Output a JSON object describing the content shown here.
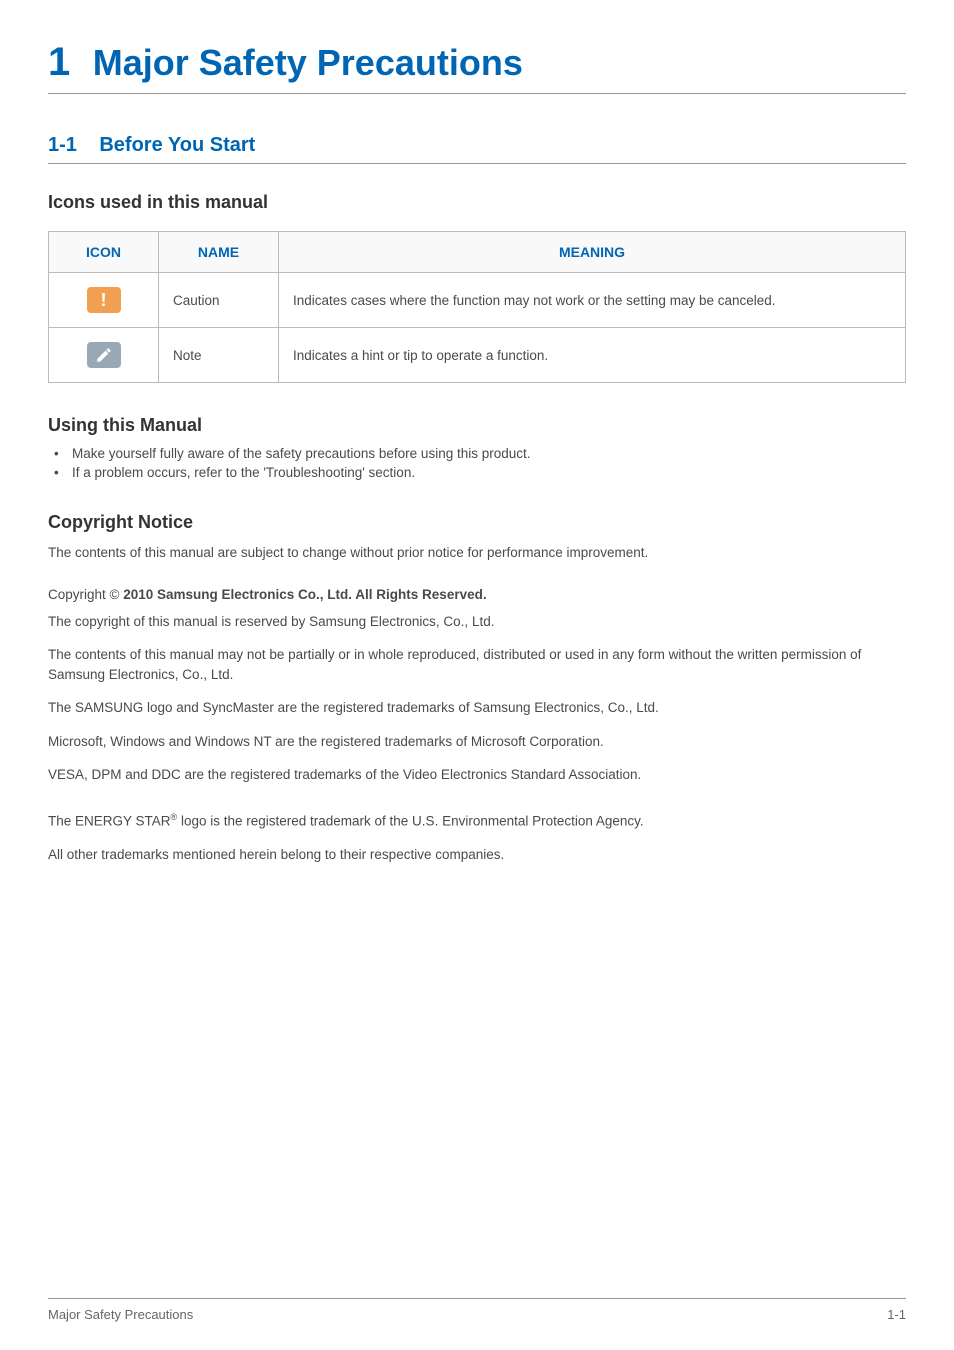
{
  "chapter": {
    "number": "1",
    "title": "Major Safety Precautions"
  },
  "section": {
    "number": "1-1",
    "title": "Before You Start"
  },
  "icons_table": {
    "heading": "Icons used in this manual",
    "headers": {
      "icon": "ICON",
      "name": "NAME",
      "meaning": "MEANING"
    },
    "rows": [
      {
        "name": "Caution",
        "meaning": "Indicates cases where the function may not work or the setting may be canceled."
      },
      {
        "name": "Note",
        "meaning": "Indicates a hint or tip to operate a function."
      }
    ]
  },
  "using_manual": {
    "heading": "Using this Manual",
    "bullets": [
      "Make yourself fully aware of the safety precautions before using this product.",
      "If a problem occurs, refer to the 'Troubleshooting' section."
    ]
  },
  "copyright": {
    "heading": "Copyright Notice",
    "intro": "The contents of this manual are subject to change without prior notice for performance improvement.",
    "line_prefix": "Copyright © ",
    "line_bold": " 2010 Samsung Electronics Co., Ltd. All Rights Reserved.",
    "paragraphs": [
      "The copyright of this manual is reserved by Samsung Electronics, Co., Ltd.",
      "The contents of this manual may not be partially or in whole reproduced, distributed or used in any form without the written permission of Samsung Electronics, Co., Ltd.",
      "The SAMSUNG logo and SyncMaster are the registered trademarks of Samsung Electronics, Co., Ltd.",
      "Microsoft, Windows and Windows NT are the registered trademarks of Microsoft Corporation.",
      "VESA, DPM and DDC are the registered trademarks of the Video Electronics Standard Association."
    ],
    "energy_star_pre": "The ENERGY STAR",
    "energy_star_sup": "®",
    "energy_star_post": " logo is the registered trademark of the U.S. Environmental Protection Agency.",
    "final": "All other trademarks mentioned herein belong to their respective companies."
  },
  "footer": {
    "left": "Major Safety Precautions",
    "right": "1-1"
  }
}
